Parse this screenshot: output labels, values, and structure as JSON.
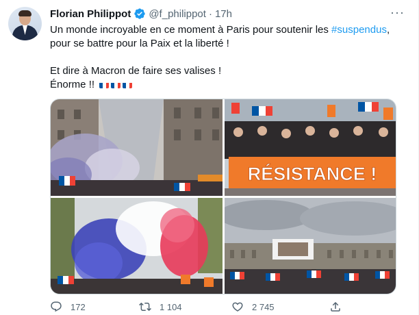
{
  "author": {
    "name": "Florian Philippot",
    "handle": "@f_philippot",
    "separator": "·",
    "time": "17h"
  },
  "tweet": {
    "line1_text": "Un monde incroyable en ce moment à Paris pour soutenir les ",
    "line1_hashtag": "#suspendus",
    "line1_end": ",",
    "line2": "pour se battre pour la Paix et la liberté !",
    "line3": "Et dire à Macron de faire ses valises !",
    "line4": "Énorme !!",
    "flags_count": 3
  },
  "media": {
    "banner_text": "RÉSISTANCE !"
  },
  "actions": {
    "replies": "172",
    "retweets": "1 104",
    "likes": "2 745"
  },
  "colors": {
    "accent": "#1d9bf0",
    "muted": "#536471",
    "flag_blue": "#0055a4",
    "flag_red": "#ef4135"
  },
  "icons": [
    "verified-badge-icon",
    "more-icon",
    "reply-icon",
    "retweet-icon",
    "like-icon",
    "share-icon"
  ]
}
